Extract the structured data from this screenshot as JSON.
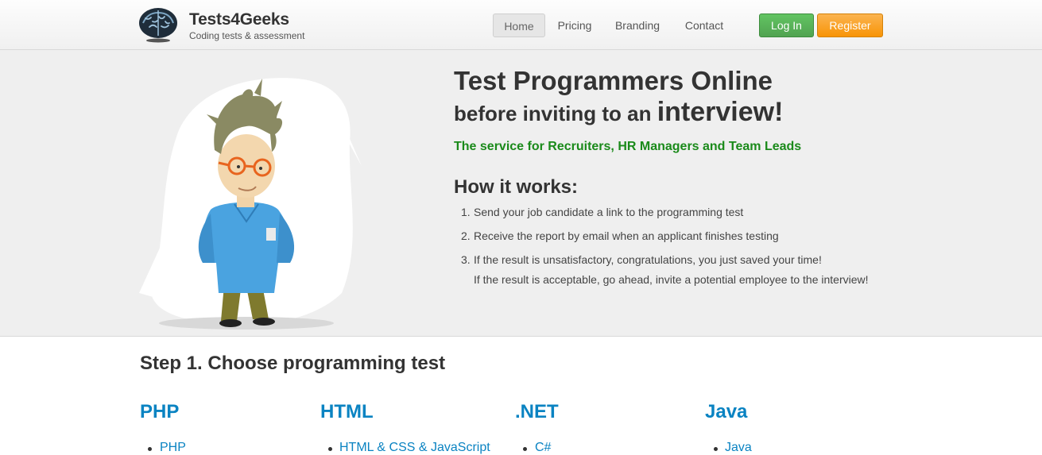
{
  "header": {
    "brand_name": "Tests4Geeks",
    "brand_tagline": "Coding tests & assessment",
    "nav": {
      "home": "Home",
      "pricing": "Pricing",
      "branding": "Branding",
      "contact": "Contact"
    },
    "login_label": "Log In",
    "register_label": "Register"
  },
  "hero": {
    "title": "Test Programmers Online",
    "subtitle_prefix": "before inviting to an",
    "subtitle_emphasis": "interview!",
    "tagline": "The service for Recruiters, HR Managers and Team Leads",
    "how_title": "How it works:",
    "steps": [
      {
        "num": "1.",
        "text": "Send your job candidate a link to the programming test"
      },
      {
        "num": "2.",
        "text": "Receive the report by email when an applicant finishes testing"
      },
      {
        "num": "3.",
        "text": "If the result is unsatisfactory, congratulations, you just saved your time!",
        "text2": "If the result is acceptable, go ahead, invite a potential employee to the interview!"
      }
    ]
  },
  "step1": {
    "title": "Step 1. Choose programming test",
    "categories": [
      {
        "title": "PHP",
        "items": [
          "PHP"
        ]
      },
      {
        "title": "HTML",
        "items": [
          "HTML & CSS & JavaScript"
        ]
      },
      {
        "title": ".NET",
        "items": [
          "C#"
        ]
      },
      {
        "title": "Java",
        "items": [
          "Java"
        ]
      }
    ]
  },
  "colors": {
    "link": "#0a83c2",
    "tagline_green": "#1a8a1a",
    "login_green": "#51a351",
    "register_orange": "#f89406",
    "hero_bg": "#efefef"
  }
}
